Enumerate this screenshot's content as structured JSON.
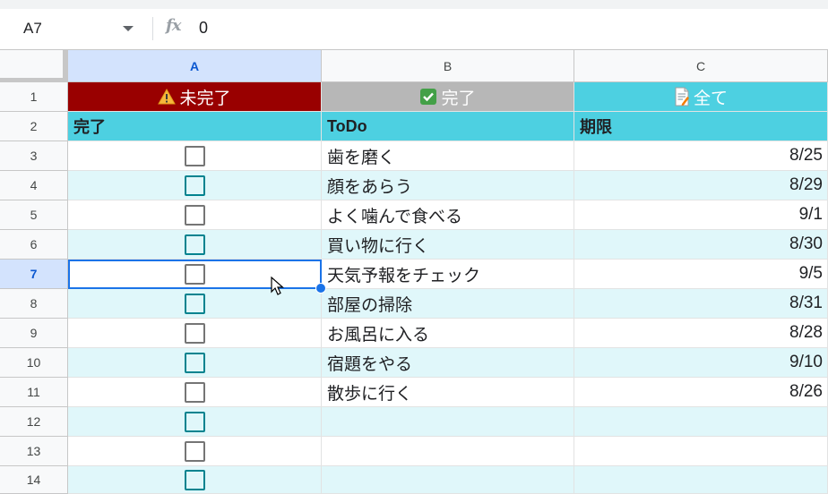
{
  "formula_bar": {
    "cell_ref": "A7",
    "fx_label": "fx",
    "value": "0"
  },
  "columns": [
    "A",
    "B",
    "C"
  ],
  "selected_column": "A",
  "selected_row": "7",
  "row_numbers": [
    "1",
    "2",
    "3",
    "4",
    "5",
    "6",
    "7",
    "8",
    "9",
    "10",
    "11",
    "12",
    "13",
    "14"
  ],
  "buttons": {
    "incomplete": "未完了",
    "complete": "完了",
    "all": "全て"
  },
  "header_row": {
    "done": "完了",
    "todo": "ToDo",
    "due": "期限"
  },
  "tasks": [
    {
      "todo": "歯を磨く",
      "due": "8/25",
      "checked": false
    },
    {
      "todo": "顔をあらう",
      "due": "8/29",
      "checked": false
    },
    {
      "todo": "よく噛んで食べる",
      "due": "9/1",
      "checked": false
    },
    {
      "todo": "買い物に行く",
      "due": "8/30",
      "checked": false
    },
    {
      "todo": "天気予報をチェック",
      "due": "9/5",
      "checked": false
    },
    {
      "todo": "部屋の掃除",
      "due": "8/31",
      "checked": false
    },
    {
      "todo": "お風呂に入る",
      "due": "8/28",
      "checked": false
    },
    {
      "todo": "宿題をやる",
      "due": "9/10",
      "checked": false
    },
    {
      "todo": "散歩に行く",
      "due": "8/26",
      "checked": false
    },
    {
      "todo": "",
      "due": "",
      "checked": false
    },
    {
      "todo": "",
      "due": "",
      "checked": false
    },
    {
      "todo": "",
      "due": "",
      "checked": false
    }
  ],
  "colors": {
    "incomplete_bg": "#990000",
    "complete_bg": "#b7b7b7",
    "all_bg": "#4dd0e1",
    "header_bg": "#4dd0e1",
    "band_bg": "#e0f7fa",
    "selection": "#1a73e8"
  },
  "icons": {
    "incomplete": "warning-icon",
    "complete": "checkmark-icon",
    "all": "memo-icon"
  }
}
